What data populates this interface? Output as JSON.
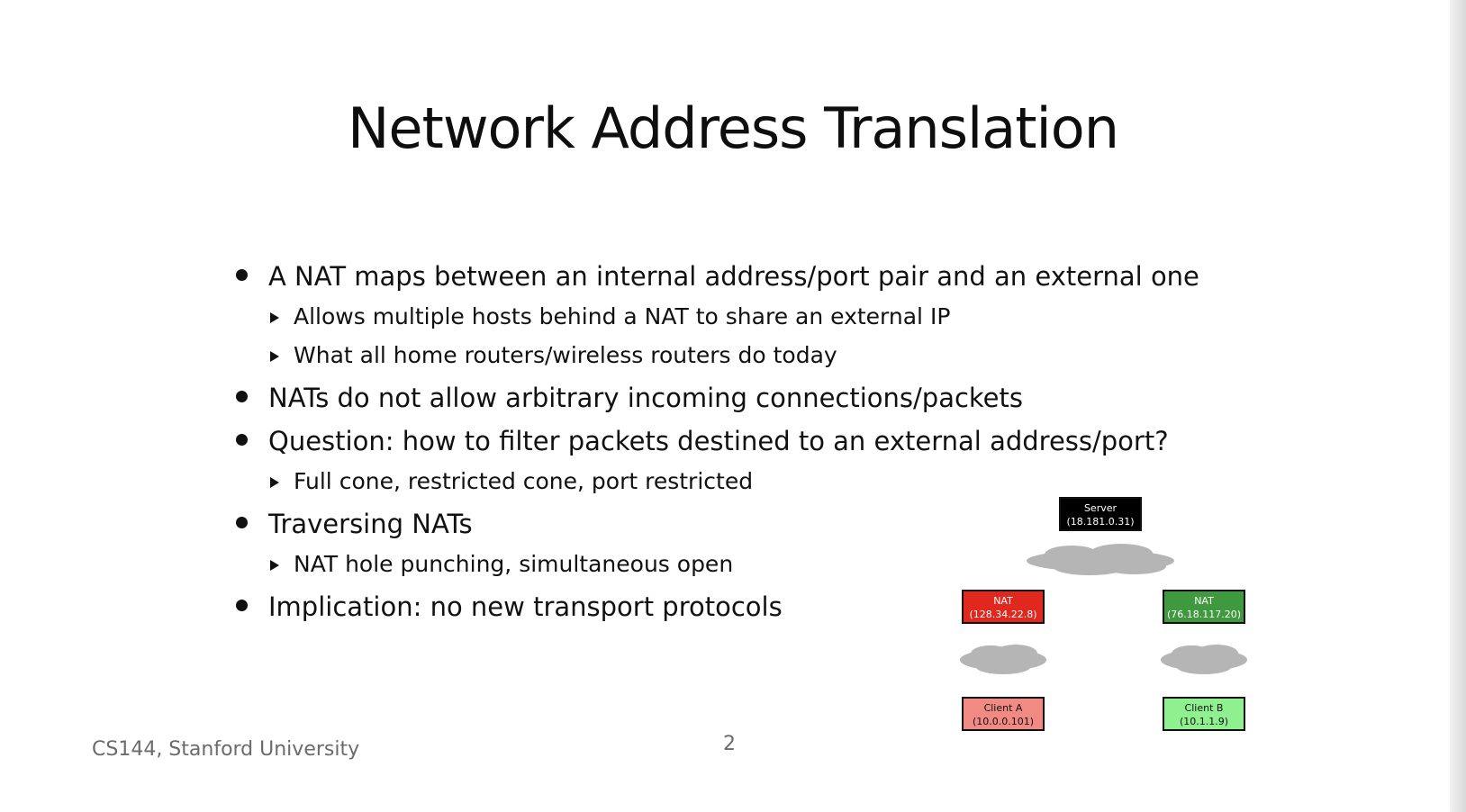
{
  "slide": {
    "title": "Network Address Translation",
    "bullets": [
      {
        "level": 1,
        "text": "A NAT maps between an internal address/port pair and an external one"
      },
      {
        "level": 2,
        "text": "Allows multiple hosts behind a NAT to share an external IP"
      },
      {
        "level": 2,
        "text": "What all home routers/wireless routers do today"
      },
      {
        "level": 1,
        "text": "NATs do not allow arbitrary incoming connections/packets"
      },
      {
        "level": 1,
        "text": "Question: how to filter packets destined to an external address/port?"
      },
      {
        "level": 2,
        "text": "Full cone, restricted cone, port restricted"
      },
      {
        "level": 1,
        "text": "Traversing NATs"
      },
      {
        "level": 2,
        "text": "NAT hole punching, simultaneous open"
      },
      {
        "level": 1,
        "text": "Implication: no new transport protocols"
      }
    ],
    "footer": "CS144, Stanford University",
    "page_number": "2"
  },
  "diagram": {
    "server": {
      "label": "Server",
      "address": "(18.181.0.31)"
    },
    "nat_a": {
      "label": "NAT",
      "address": "(128.34.22.8)"
    },
    "nat_b": {
      "label": "NAT",
      "address": "(76.18.117.20)"
    },
    "client_a": {
      "label": "Client A",
      "address": "(10.0.0.101)"
    },
    "client_b": {
      "label": "Client B",
      "address": "(10.1.1.9)"
    }
  },
  "colors": {
    "server": "#000000",
    "nat_a": "#e0281e",
    "nat_b": "#3f9a3f",
    "client_a": "#f08a82",
    "client_b": "#8ff08f",
    "cloud": "#b5b5b5"
  }
}
